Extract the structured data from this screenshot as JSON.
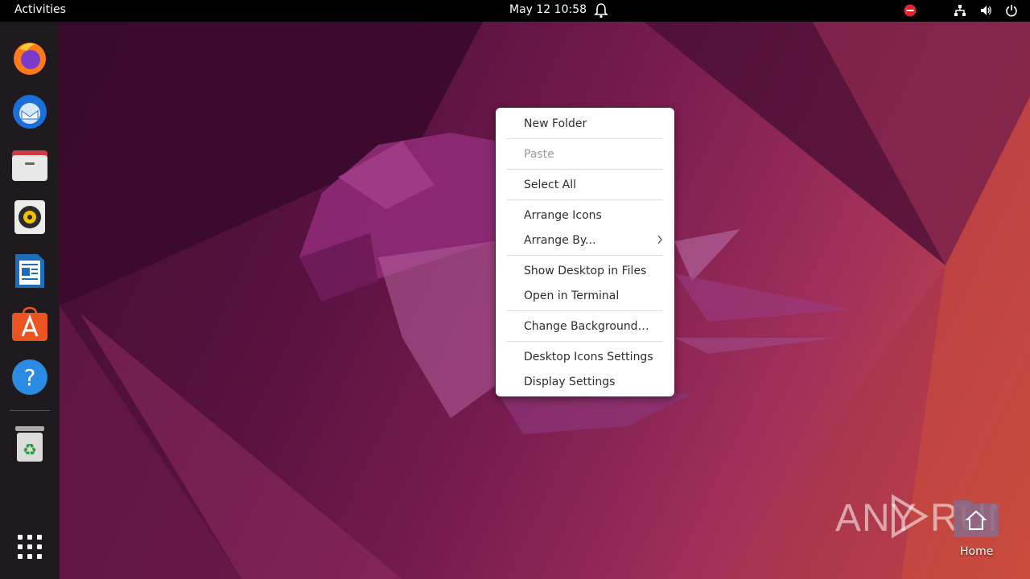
{
  "topbar": {
    "activities": "Activities",
    "clock": "May 12  10:58"
  },
  "dock": {
    "items": [
      {
        "name": "firefox-icon"
      },
      {
        "name": "thunderbird-icon"
      },
      {
        "name": "files-icon"
      },
      {
        "name": "rhythmbox-icon"
      },
      {
        "name": "libreoffice-writer-icon"
      },
      {
        "name": "ubuntu-software-icon"
      },
      {
        "name": "help-icon"
      },
      {
        "name": "trash-icon"
      },
      {
        "name": "show-apps-icon"
      }
    ]
  },
  "menu": {
    "new_folder": "New Folder",
    "paste": "Paste",
    "select_all": "Select All",
    "arrange_icons": "Arrange Icons",
    "arrange_by": "Arrange By...",
    "show_desktop_in_files": "Show Desktop in Files",
    "open_in_terminal": "Open in Terminal",
    "change_background": "Change Background…",
    "desktop_icons_settings": "Desktop Icons Settings",
    "display_settings": "Display Settings"
  },
  "desktop": {
    "home_label": "Home"
  },
  "watermark": "ANY RUN",
  "colors": {
    "topbar": "#000000",
    "dock": "#1e1a1d",
    "menu_bg": "#ffffff"
  }
}
